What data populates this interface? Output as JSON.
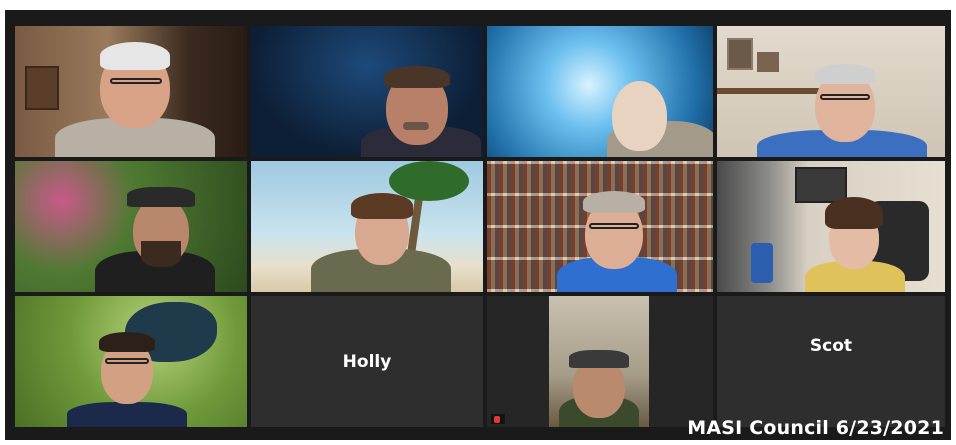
{
  "meeting": {
    "watermark": "MASI Council 6/23/2021"
  },
  "tiles": [
    {
      "name_label": "",
      "bg": "#6b4f3a"
    },
    {
      "name_label": "",
      "bg": "#0f2340"
    },
    {
      "name_label": "",
      "bg": "#4aa0d8"
    },
    {
      "name_label": "",
      "bg": "#d8cfc0"
    },
    {
      "name_label": "",
      "bg": "#3f6a2e"
    },
    {
      "name_label": "",
      "bg": "#8fc0d9"
    },
    {
      "name_label": "",
      "bg": "#5a3a22"
    },
    {
      "name_label": "",
      "bg": "#c9c4bb"
    },
    {
      "name_label": "",
      "bg": "#7fa24a"
    },
    {
      "name_label": "Holly",
      "bg": "#2e2e2e"
    },
    {
      "name_label": "",
      "bg": "#262626"
    },
    {
      "name_label": "Scot",
      "bg": "#2e2e2e"
    }
  ],
  "colors": {
    "speaker_outline": "#d9d56a",
    "tile_off": "#2e2e2e",
    "frame": "#1a1a1a"
  }
}
